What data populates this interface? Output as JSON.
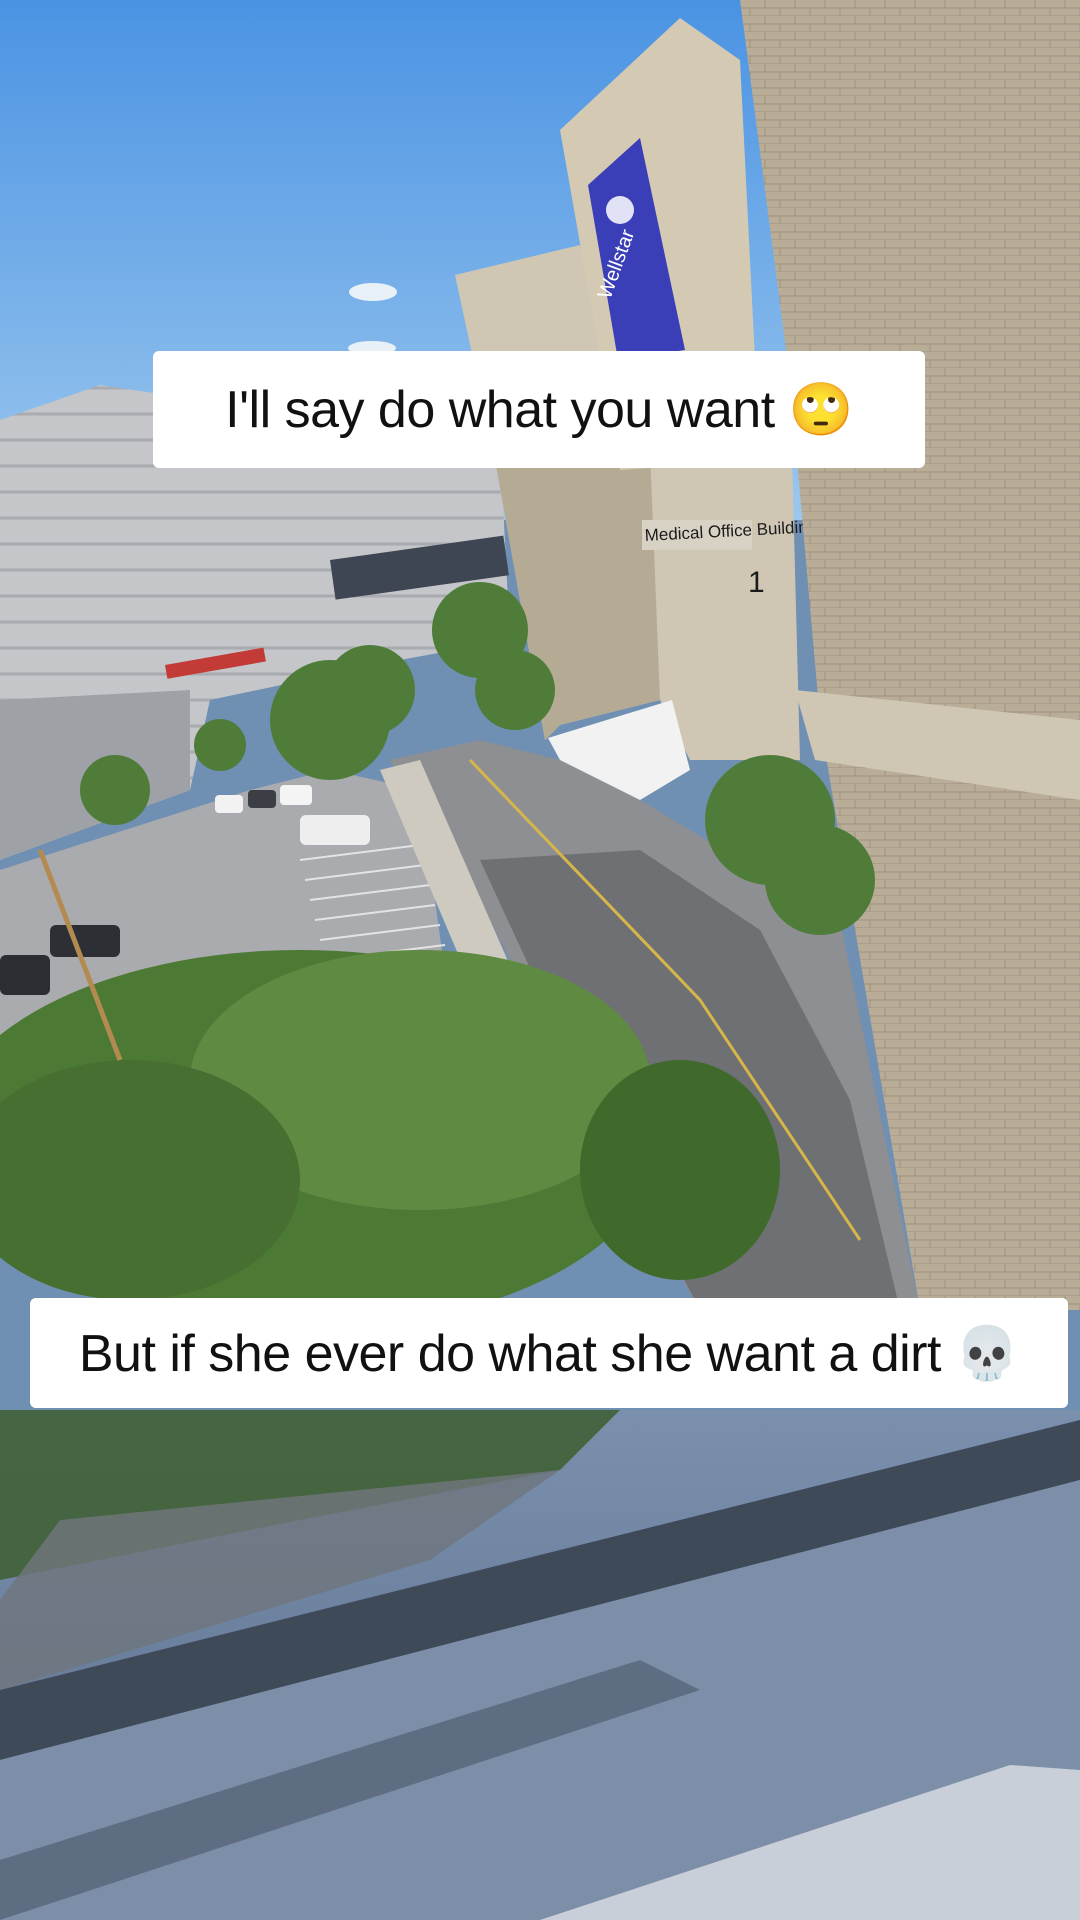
{
  "captions": {
    "top": "I'll say do what you want 🙄",
    "bottom": "But if she ever do what she want a dirt 💀"
  },
  "scene": {
    "building_sign_1": "Wellstar",
    "building_sign_2": "Medical Office Building",
    "building_number": "1",
    "colors": {
      "sky": "#5d9fe6",
      "brick": "#b9ad98",
      "concrete": "#cfc6b4",
      "foliage": "#4f7d39",
      "asphalt": "#8d8f92",
      "sign_blue": "#3a3fb8"
    }
  }
}
